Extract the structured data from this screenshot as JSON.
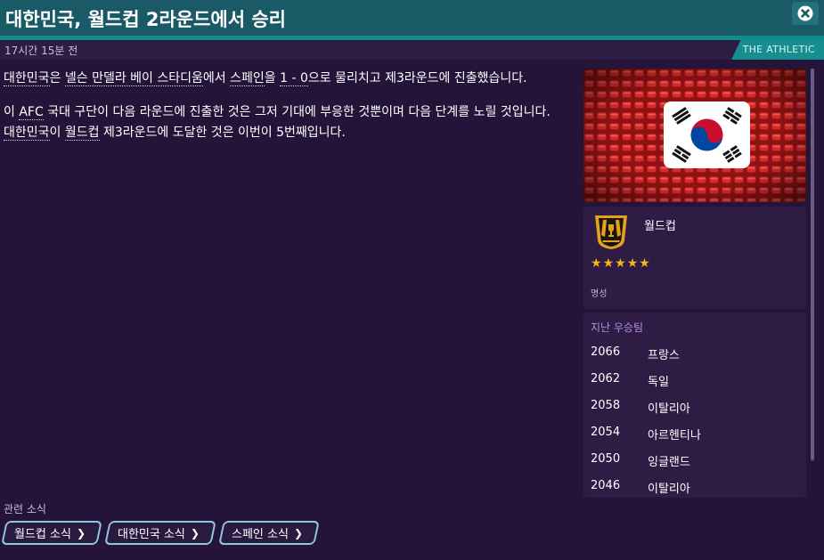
{
  "header": {
    "title": "대한민국, 월드컵 2라운드에서 승리"
  },
  "meta": {
    "time": "17시간 15분 전",
    "source": "THE ATHLETIC"
  },
  "article": {
    "p1_t1": "대한민국",
    "p1_t2": "은 ",
    "p1_t3": "넬슨 만델라 베이 스타디움",
    "p1_t4": "에서 ",
    "p1_t5": "스페인",
    "p1_t6": "을 ",
    "p1_t7": "1 - 0",
    "p1_t8": "으로 물리치고 제3라운드에 진출했습니다.",
    "p2_t1": "이 ",
    "p2_t2": "AFC",
    "p2_t3": " 국대 구단이 다음 라운드에 진출한 것은 그저 기대에 부응한 것뿐이며 다음 단계를 노릴 것입니다. ",
    "p2_t4": "대한민국",
    "p2_t5": "이 ",
    "p2_t6": "월드컵",
    "p2_t7": " 제3라운드에 도달한 것은 이번이 5번째입니다."
  },
  "related": {
    "label": "관련 소식",
    "chips": [
      {
        "label": "월드컵 소식"
      },
      {
        "label": "대한민국 소식"
      },
      {
        "label": "스페인 소식"
      }
    ]
  },
  "competition": {
    "name": "월드컵",
    "stars": 5,
    "reputation_label": "명성"
  },
  "winners": {
    "title": "지난 우승팀",
    "rows": [
      {
        "year": "2066",
        "team": "프랑스"
      },
      {
        "year": "2062",
        "team": "독일"
      },
      {
        "year": "2058",
        "team": "이탈리아"
      },
      {
        "year": "2054",
        "team": "아르헨티나"
      },
      {
        "year": "2050",
        "team": "잉글랜드"
      },
      {
        "year": "2046",
        "team": "이탈리아"
      }
    ]
  },
  "colors": {
    "background": "#24143a",
    "header": "#1a5a66",
    "accent_teal": "#128b8f",
    "star": "#f5b417",
    "chip_border": "#8fc6e4",
    "section_title": "#b58ee0"
  },
  "icons": {
    "close": "close-circle-icon",
    "chip_arrow": "chevron-right-icon",
    "flag": "south-korea-flag-icon",
    "competition_logo": "world-cup-logo-icon",
    "star": "star-icon"
  }
}
